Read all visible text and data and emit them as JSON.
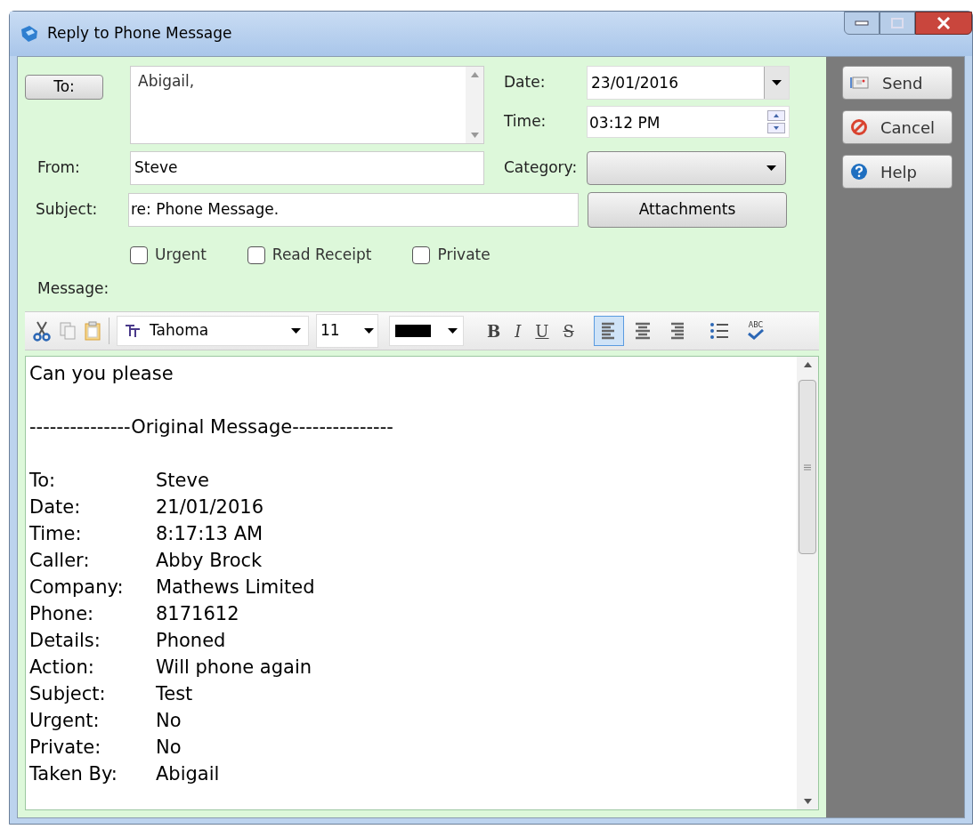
{
  "window": {
    "title": "Reply to Phone Message"
  },
  "to_button": "To:",
  "to_value": "Abigail,",
  "date": {
    "label": "Date:",
    "value": "23/01/2016"
  },
  "time": {
    "label": "Time:",
    "value": "03:12 PM"
  },
  "from": {
    "label": "From:",
    "value": "Steve"
  },
  "category": {
    "label": "Category:"
  },
  "subject": {
    "label": "Subject:",
    "value": "re: Phone Message."
  },
  "attachments_button": "Attachments",
  "options": [
    {
      "label": "Urgent",
      "checked": false
    },
    {
      "label": "Read Receipt",
      "checked": false
    },
    {
      "label": "Private",
      "checked": false
    }
  ],
  "message_label": "Message:",
  "toolbar": {
    "font": "Tahoma",
    "size": "11",
    "format": [
      {
        "kind": "bold",
        "label": "B"
      },
      {
        "kind": "italic",
        "label": "I"
      },
      {
        "kind": "underline",
        "label": "U"
      },
      {
        "kind": "strike",
        "label": "S"
      }
    ],
    "align": [
      {
        "kind": "left",
        "selected": true
      },
      {
        "kind": "center",
        "selected": false
      },
      {
        "kind": "right",
        "selected": false
      }
    ],
    "spell": "ABC"
  },
  "message_lines": [
    {
      "kind": "text",
      "text": "Can you please"
    },
    {
      "kind": "blank"
    },
    {
      "kind": "text",
      "text": "---------------Original Message---------------"
    },
    {
      "kind": "blank"
    },
    {
      "kind": "field",
      "label": "To:",
      "value": "Steve"
    },
    {
      "kind": "field",
      "label": "Date:",
      "value": "21/01/2016"
    },
    {
      "kind": "field",
      "label": "Time:",
      "value": "8:17:13 AM"
    },
    {
      "kind": "field",
      "label": "Caller:",
      "value": "Abby Brock"
    },
    {
      "kind": "field",
      "label": "Company:",
      "value": "Mathews Limited"
    },
    {
      "kind": "field",
      "label": "Phone:",
      "value": "8171612"
    },
    {
      "kind": "field",
      "label": "Details:",
      "value": "Phoned"
    },
    {
      "kind": "field",
      "label": "Action:",
      "value": "Will phone again"
    },
    {
      "kind": "field",
      "label": "Subject:",
      "value": "Test"
    },
    {
      "kind": "field",
      "label": "Urgent:",
      "value": "No"
    },
    {
      "kind": "field",
      "label": "Private:",
      "value": "No"
    },
    {
      "kind": "field",
      "label": "Taken By:",
      "value": "Abigail"
    }
  ],
  "side_buttons": [
    {
      "kind": "send",
      "label": "Send"
    },
    {
      "kind": "cancel",
      "label": "Cancel"
    },
    {
      "kind": "help",
      "label": "Help"
    }
  ]
}
